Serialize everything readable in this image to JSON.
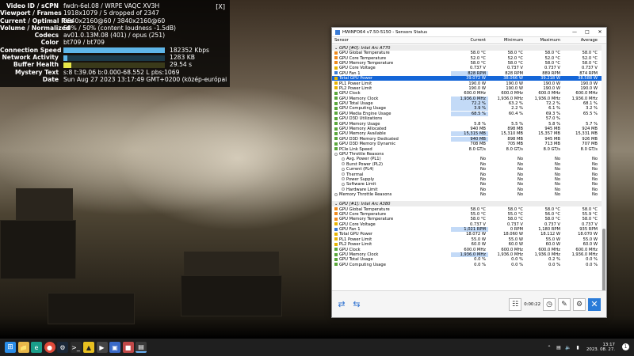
{
  "stats": {
    "close": "[X]",
    "rows": [
      {
        "label": "Video ID / sCPN",
        "value": "fwdn-6el.08 / WRPE VAQC XV3H"
      },
      {
        "label": "Viewport / Frames",
        "value": "1918x1079 / 5 dropped of 2347"
      },
      {
        "label": "Current / Optimal Res",
        "value": "3840x2160@60 / 3840x2160@60"
      },
      {
        "label": "Volume / Normalized",
        "value": "50% / 50% (content loudness -1.5dB)"
      },
      {
        "label": "Codecs",
        "value": "av01.0.13M.08 (401) / opus (251)"
      },
      {
        "label": "Color",
        "value": "bt709 / bt709"
      }
    ],
    "connection_label": "Connection Speed",
    "connection_value": "182352 Kbps",
    "network_label": "Network Activity",
    "network_value": "1283 KB",
    "buffer_label": "Buffer Health",
    "buffer_value": "29.54 s",
    "mystery_label": "Mystery Text",
    "mystery_value": "s:8 t:39.06 b:0.000-68.552 L pbs:1069",
    "date_label": "Date",
    "date_value": "Sun Aug 27 2023 13:17:49 GMT+0200 (közép-európai nyári idő)"
  },
  "hwinfo": {
    "title": "HWiNFO64 v7.50-5150 - Sensors Status",
    "columns": [
      "Sensor",
      "Current",
      "Minimum",
      "Maximum",
      "Average"
    ],
    "group1": "GPU [#0]: Intel Arc A770",
    "rows1": [
      [
        "GPU Global Temperature",
        "58.0 °C",
        "58.0 °C",
        "58.0 °C",
        "58.0 °C"
      ],
      [
        "GPU Core Temperature",
        "52.0 °C",
        "52.0 °C",
        "52.0 °C",
        "52.0 °C"
      ],
      [
        "GPU Memory Temperature",
        "58.0 °C",
        "58.0 °C",
        "58.0 °C",
        "58.0 °C"
      ],
      [
        "GPU Core Voltage",
        "0.737 V",
        "0.737 V",
        "0.737 V",
        "0.737 V"
      ],
      [
        "GPU Fan 1",
        "828 RPM",
        "828 RPM",
        "889 RPM",
        "874 RPM"
      ],
      [
        "Total GPU Power",
        "39.072 W",
        "38.066 W",
        "39.218 W",
        "38.588 W"
      ],
      [
        "PL1 Power Limit",
        "190.0 W",
        "190.0 W",
        "190.0 W",
        "190.0 W"
      ],
      [
        "PL2 Power Limit",
        "190.0 W",
        "190.0 W",
        "190.0 W",
        "190.0 W"
      ],
      [
        "GPU Clock",
        "600.0 MHz",
        "600.0 MHz",
        "600.0 MHz",
        "600.0 MHz"
      ],
      [
        "GPU Memory Clock",
        "1,936.0 MHz",
        "1,936.0 MHz",
        "1,936.0 MHz",
        "1,936.0 MHz"
      ],
      [
        "GPU Total Usage",
        "72.2 %",
        "63.2 %",
        "72.2 %",
        "68.1 %"
      ],
      [
        "GPU Computing Usage",
        "3.9 %",
        "2.2 %",
        "6.1 %",
        "3.2 %"
      ],
      [
        "GPU Media Engine Usage",
        "68.5 %",
        "60.4 %",
        "69.3 %",
        "65.5 %"
      ],
      [
        "GPU D3D Utilizations",
        "",
        "",
        "57.0 %",
        ""
      ],
      [
        "GPU Memory Usage",
        "5.8 %",
        "5.5 %",
        "5.8 %",
        "5.7 %"
      ],
      [
        "GPU Memory Allocated",
        "940 MB",
        "898 MB",
        "945 MB",
        "924 MB"
      ],
      [
        "GPU Memory Available",
        "15,315 MB",
        "15,310 MB",
        "15,357 MB",
        "15,331 MB"
      ],
      [
        "GPU D3D Memory Dedicated",
        "940 MB",
        "898 MB",
        "945 MB",
        "926 MB"
      ],
      [
        "GPU D3D Memory Dynamic",
        "708 MB",
        "705 MB",
        "713 MB",
        "707 MB"
      ],
      [
        "PCIe Link Speed",
        "8.0 GT/s",
        "8.0 GT/s",
        "8.0 GT/s",
        "8.0 GT/s"
      ],
      [
        "GPU Throttle Reasons",
        "",
        "",
        "",
        ""
      ],
      [
        "Avg. Power (PL1)",
        "No",
        "No",
        "No",
        "No"
      ],
      [
        "Burst Power (PL2)",
        "No",
        "No",
        "No",
        "No"
      ],
      [
        "Current (PL4)",
        "No",
        "No",
        "No",
        "No"
      ],
      [
        "Thermal",
        "No",
        "No",
        "No",
        "No"
      ],
      [
        "Power Supply",
        "No",
        "No",
        "No",
        "No"
      ],
      [
        "Software Limit",
        "No",
        "No",
        "No",
        "No"
      ],
      [
        "Hardware Limit",
        "No",
        "No",
        "No",
        "No"
      ],
      [
        "Memory Throttle Reasons",
        "No",
        "No",
        "No",
        "No"
      ]
    ],
    "group2": "GPU [#1]: Intel Arc A380",
    "rows2": [
      [
        "GPU Global Temperature",
        "58.0 °C",
        "58.0 °C",
        "58.0 °C",
        "58.0 °C"
      ],
      [
        "GPU Core Temperature",
        "55.0 °C",
        "55.0 °C",
        "56.0 °C",
        "55.9 °C"
      ],
      [
        "GPU Memory Temperature",
        "58.0 °C",
        "58.0 °C",
        "58.0 °C",
        "58.0 °C"
      ],
      [
        "GPU Core Voltage",
        "0.737 V",
        "0.737 V",
        "0.737 V",
        "0.737 V"
      ],
      [
        "GPU Fan 1",
        "1,021 RPM",
        "0 RPM",
        "1,180 RPM",
        "935 RPM"
      ],
      [
        "Total GPU Power",
        "18.072 W",
        "18.060 W",
        "18.112 W",
        "18.070 W"
      ],
      [
        "PL1 Power Limit",
        "55.0 W",
        "55.0 W",
        "55.0 W",
        "55.0 W"
      ],
      [
        "PL2 Power Limit",
        "60.0 W",
        "60.0 W",
        "60.0 W",
        "60.0 W"
      ],
      [
        "GPU Clock",
        "600.0 MHz",
        "600.0 MHz",
        "600.0 MHz",
        "600.0 MHz"
      ],
      [
        "GPU Memory Clock",
        "1,936.0 MHz",
        "1,936.0 MHz",
        "1,936.0 MHz",
        "1,936.0 MHz"
      ],
      [
        "GPU Total Usage",
        "0.0 %",
        "0.0 %",
        "0.2 %",
        "0.0 %"
      ],
      [
        "GPU Computing Usage",
        "0.0 %",
        "0.0 %",
        "0.0 %",
        "0.0 %"
      ]
    ],
    "timer": "0:00:22"
  },
  "taskbar": {
    "clock_time": "13:17",
    "clock_date": "2023. 08. 27.",
    "notif": "1"
  }
}
